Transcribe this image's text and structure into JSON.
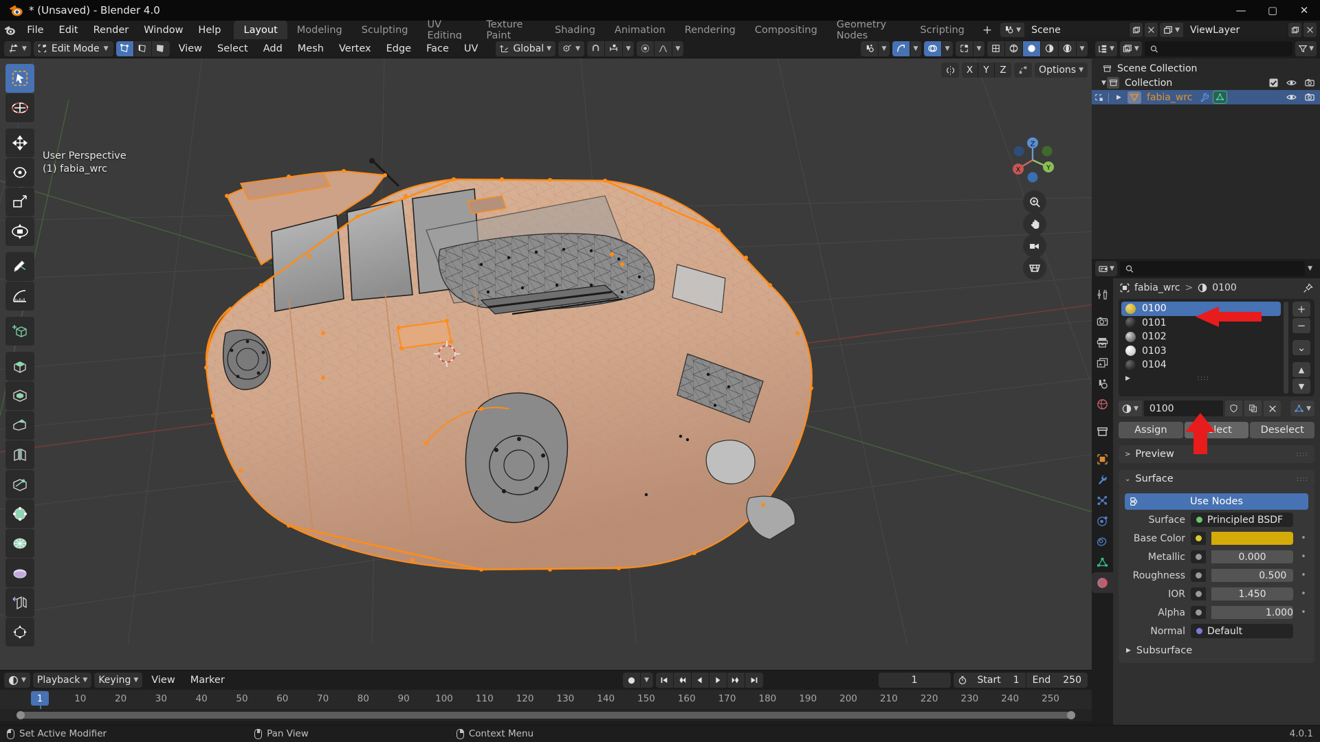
{
  "titlebar": {
    "title": "* (Unsaved) - Blender 4.0",
    "minimize": "—",
    "maximize": "▢",
    "close": "✕"
  },
  "topbar": {
    "menus": [
      "File",
      "Edit",
      "Render",
      "Window",
      "Help"
    ],
    "workspaces": [
      "Layout",
      "Modeling",
      "Sculpting",
      "UV Editing",
      "Texture Paint",
      "Shading",
      "Animation",
      "Rendering",
      "Compositing",
      "Geometry Nodes",
      "Scripting"
    ],
    "active_workspace": "Layout",
    "add_workspace": "+",
    "scene_name": "Scene",
    "viewlayer_name": "ViewLayer"
  },
  "viewport_header": {
    "mode": "Edit Mode",
    "menus": [
      "View",
      "Select",
      "Add",
      "Mesh",
      "Vertex",
      "Edge",
      "Face",
      "UV"
    ],
    "transform_orientation": "Global",
    "select_mode": [
      "vertex",
      "edge",
      "face"
    ],
    "active_select_mode": "vertex"
  },
  "viewport_options": {
    "proportional_axes": [
      "X",
      "Y",
      "Z"
    ],
    "options_label": "Options"
  },
  "viewport_overlay": {
    "perspective": "User Perspective",
    "object": "(1) fabia_wrc"
  },
  "gizmo": {
    "axis_z": "Z",
    "axis_x": "X",
    "axis_y": "Y"
  },
  "toolbar": {
    "tools": [
      {
        "name": "tweak-tool",
        "icon": "cursor-select"
      },
      {
        "name": "cursor-tool",
        "icon": "3d-cursor"
      },
      {
        "name": "move-tool",
        "icon": "move"
      },
      {
        "name": "rotate-tool",
        "icon": "rotate"
      },
      {
        "name": "scale-tool",
        "icon": "scale"
      },
      {
        "name": "transform-tool",
        "icon": "transform"
      },
      {
        "name": "annotate-tool",
        "icon": "pencil"
      },
      {
        "name": "measure-tool",
        "icon": "ruler"
      },
      {
        "name": "add-cube-tool",
        "icon": "add-cube"
      },
      {
        "name": "extrude-region-tool",
        "icon": "extrude"
      },
      {
        "name": "inset-faces-tool",
        "icon": "inset"
      },
      {
        "name": "bevel-tool",
        "icon": "bevel"
      },
      {
        "name": "loop-cut-tool",
        "icon": "loop-cut"
      },
      {
        "name": "knife-tool",
        "icon": "knife"
      },
      {
        "name": "poly-build-tool",
        "icon": "poly-build"
      },
      {
        "name": "spin-tool",
        "icon": "spin"
      },
      {
        "name": "smooth-tool",
        "icon": "smooth"
      },
      {
        "name": "edge-slide-tool",
        "icon": "edge-slide"
      },
      {
        "name": "shrink-fatten-tool",
        "icon": "shrink-fatten"
      }
    ],
    "active_index": 0
  },
  "outliner": {
    "search_placeholder": "",
    "rows": [
      {
        "label": "Scene Collection",
        "indent": 0,
        "icon": "collection-icon",
        "selected": false,
        "expandable": false,
        "show_toggles": false
      },
      {
        "label": "Collection",
        "indent": 1,
        "icon": "collection-icon",
        "selected": false,
        "expandable": true,
        "show_toggles": true,
        "checkbox": "✔"
      },
      {
        "label": "fabia_wrc",
        "indent": 2,
        "icon": "mesh-object-icon",
        "selected": true,
        "expandable": true,
        "show_toggles": true
      }
    ]
  },
  "properties": {
    "search_placeholder": "",
    "breadcrumb": [
      "fabia_wrc",
      "0100"
    ],
    "tabs": [
      "tool-icon",
      "render-icon",
      "output-icon",
      "view-layer-icon",
      "scene-icon",
      "world-icon",
      "collection-icon",
      "object-icon",
      "modifier-icon",
      "particles-icon",
      "physics-icon",
      "constraints-icon",
      "data-icon",
      "material-icon"
    ],
    "active_tab": "material-icon",
    "material_slots": [
      {
        "name": "0100",
        "color": "#d7b93a",
        "selected": true
      },
      {
        "name": "0101",
        "color": "#1a1a1a",
        "selected": false
      },
      {
        "name": "0102",
        "color": "#8a8a8a",
        "selected": false
      },
      {
        "name": "0103",
        "color": "#e8e8e8",
        "selected": false
      },
      {
        "name": "0104",
        "color": "#1a1a1a",
        "selected": false
      }
    ],
    "side_buttons": [
      "+",
      "−",
      "⌄",
      "▲",
      "▼"
    ],
    "active_material_name": "0100",
    "assign_buttons": [
      "Assign",
      "Select",
      "Deselect"
    ],
    "active_assign_button": "Select",
    "panels": [
      {
        "label": "Preview",
        "expanded": false
      },
      {
        "label": "Surface",
        "expanded": true
      }
    ],
    "use_nodes_label": "Use Nodes",
    "surface_shader": "Principled BSDF",
    "surface_label": "Surface",
    "inputs": [
      {
        "label": "Base Color",
        "type": "color",
        "value": "",
        "color": "#d4ab09",
        "socket": "#d7c832",
        "fill": 0
      },
      {
        "label": "Metallic",
        "type": "slider",
        "value": "0.000",
        "socket": "#9a9a9a",
        "fill": 0
      },
      {
        "label": "Roughness",
        "type": "slider",
        "value": "0.500",
        "socket": "#9a9a9a",
        "fill": 50
      },
      {
        "label": "IOR",
        "type": "slider",
        "value": "1.450",
        "socket": "#9a9a9a",
        "fill": 0
      },
      {
        "label": "Alpha",
        "type": "slider",
        "value": "1.000",
        "socket": "#9a9a9a",
        "fill": 100
      },
      {
        "label": "Normal",
        "type": "link",
        "value": "Default",
        "socket": "#7b7bd4",
        "fill": 0
      }
    ],
    "subpanel": "Subsurface"
  },
  "timeline": {
    "menus": [
      "Playback",
      "Keying",
      "View",
      "Marker"
    ],
    "current_frame": "1",
    "start_label": "Start",
    "start_value": "1",
    "end_label": "End",
    "end_value": "250",
    "ticks": [
      "1",
      "10",
      "20",
      "30",
      "40",
      "50",
      "60",
      "70",
      "80",
      "90",
      "100",
      "110",
      "120",
      "130",
      "140",
      "150",
      "160",
      "170",
      "180",
      "190",
      "200",
      "210",
      "220",
      "230",
      "240",
      "250"
    ],
    "playhead_frame": "1"
  },
  "statusbar": {
    "items": [
      {
        "mouse": "left",
        "label": "Set Active Modifier"
      },
      {
        "mouse": "middle",
        "label": "Pan View"
      },
      {
        "mouse": "right",
        "label": "Context Menu"
      }
    ],
    "version": "4.0.1"
  },
  "colors": {
    "accent_blue": "#4772b3",
    "select_orange": "#ff8c19",
    "arrow_red": "#e81c1c",
    "viewport_bg": "#3b3b3b"
  }
}
